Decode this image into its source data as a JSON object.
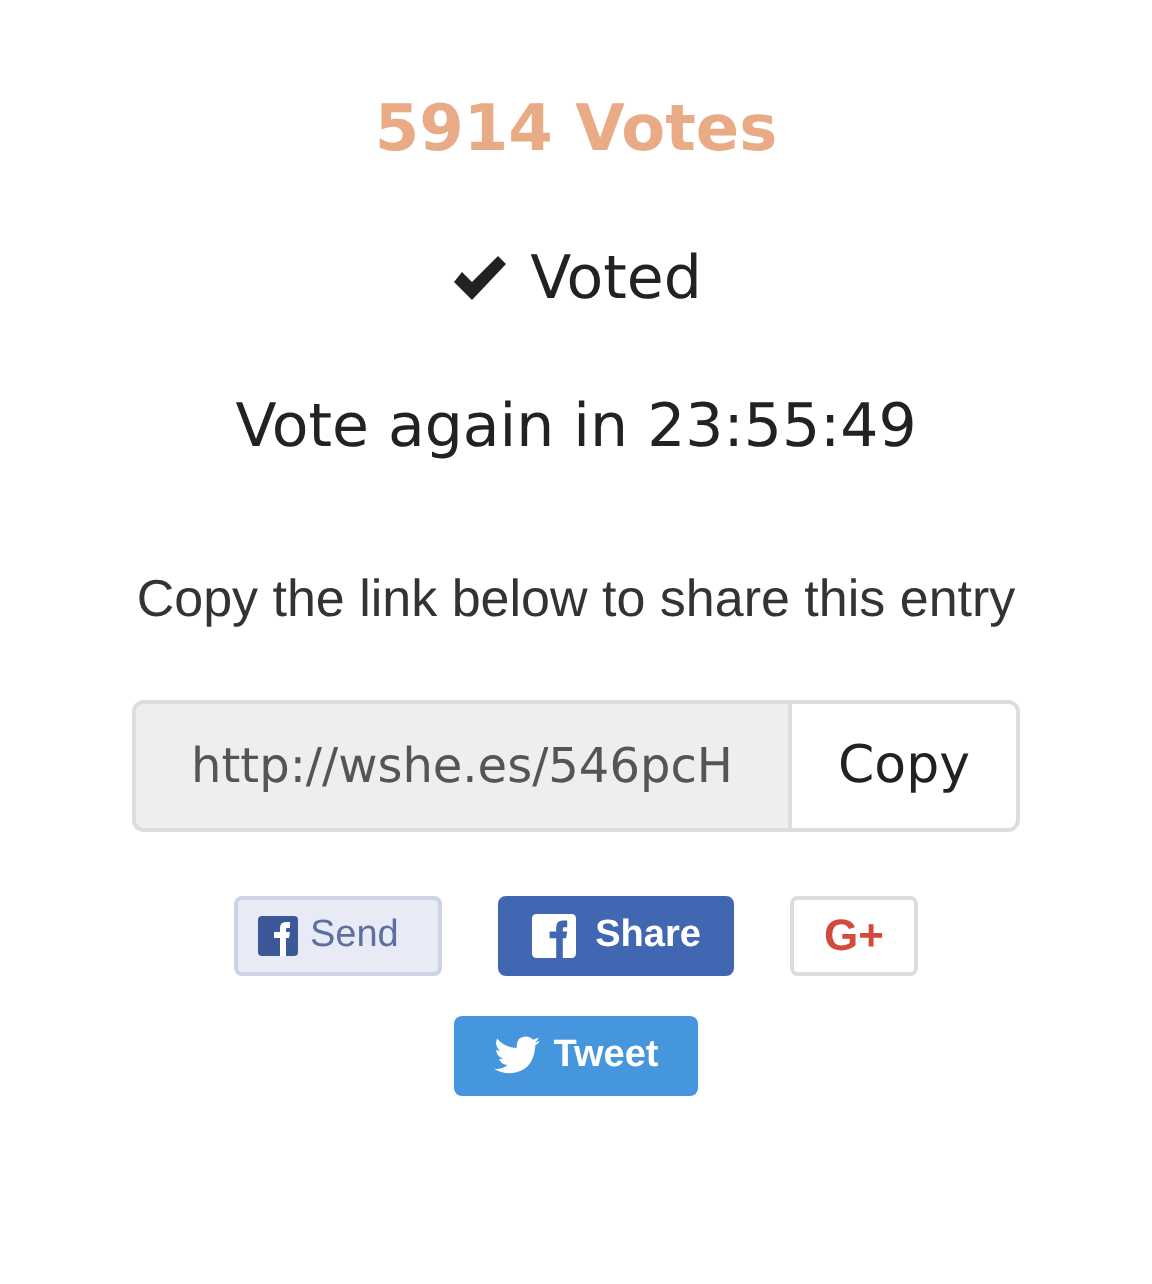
{
  "votes": "5914 Votes",
  "voted": {
    "checked": true,
    "label": "Voted"
  },
  "countdown": "Vote again in 23:55:49",
  "share_prompt": "Copy the link below to share this entry",
  "link_field": {
    "value": "http://wshe.es/546pcH"
  },
  "copy_button": "Copy",
  "social_buttons": [
    {
      "kind": "fb-send",
      "label": "Send"
    },
    {
      "kind": "fb-share",
      "label": "Share"
    },
    {
      "kind": "gplus",
      "label": "G+"
    },
    {
      "kind": "tweet",
      "label": "Tweet"
    }
  ]
}
